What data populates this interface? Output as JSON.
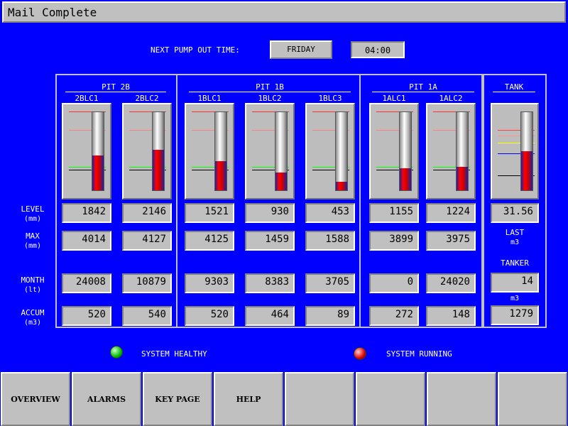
{
  "window": {
    "title": "Mail Complete"
  },
  "pump": {
    "label": "NEXT PUMP OUT TIME:",
    "day": "FRIDAY",
    "time": "04:00"
  },
  "row_labels": {
    "level": "LEVEL",
    "level_unit": "(mm)",
    "max": "MAX",
    "max_unit": "(mm)",
    "month": "MONTH",
    "month_unit": "(lt)",
    "accum": "ACCUM",
    "accum_unit": "(m3)"
  },
  "pits": [
    {
      "name": "PIT 2B"
    },
    {
      "name": "PIT 1B"
    },
    {
      "name": "PIT 1A"
    }
  ],
  "gauges": [
    {
      "name": "2BLC1",
      "level": "1842",
      "max": "4014",
      "month": "24008",
      "accum": "520",
      "fill_fraction": 0.45
    },
    {
      "name": "2BLC2",
      "level": "2146",
      "max": "4127",
      "month": "10879",
      "accum": "540",
      "fill_fraction": 0.52
    },
    {
      "name": "1BLC1",
      "level": "1521",
      "max": "4125",
      "month": "9303",
      "accum": "520",
      "fill_fraction": 0.37
    },
    {
      "name": "1BLC2",
      "level": "930",
      "max": "1459",
      "month": "8383",
      "accum": "464",
      "fill_fraction": 0.23
    },
    {
      "name": "1BLC3",
      "level": "453",
      "max": "1588",
      "month": "3705",
      "accum": "89",
      "fill_fraction": 0.11
    },
    {
      "name": "1ALC1",
      "level": "1155",
      "max": "3899",
      "month": "0",
      "accum": "272",
      "fill_fraction": 0.28
    },
    {
      "name": "1ALC2",
      "level": "1224",
      "max": "3975",
      "month": "24020",
      "accum": "148",
      "fill_fraction": 0.3
    }
  ],
  "tank": {
    "name": "TANK",
    "level": "31.56",
    "fill_fraction": 0.5,
    "last_label": "LAST",
    "last_unit": "m3",
    "tanker_label": "TANKER",
    "tanker_value": "14",
    "m3_label": "m3",
    "m3_value": "1279"
  },
  "status": {
    "healthy_label": "SYSTEM HEALTHY",
    "healthy_color": "#00c000",
    "running_label": "SYSTEM RUNNING",
    "running_color": "#e00000"
  },
  "footer": {
    "buttons": [
      "OVERVIEW",
      "ALARMS",
      "KEY PAGE",
      "HELP",
      "",
      "",
      "",
      ""
    ]
  }
}
